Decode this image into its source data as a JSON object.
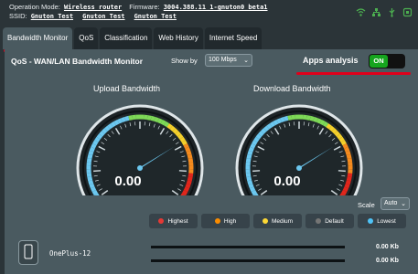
{
  "header": {
    "operation_mode_label": "Operation Mode:",
    "operation_mode": "Wireless router",
    "firmware_label": "Firmware:",
    "firmware": "3004.388.11_1-gnuton0_beta1",
    "ssid_label": "SSID:",
    "ssids": [
      "Gnuton_Test",
      "Gnuton_Test",
      "Gnuton_Test"
    ],
    "icons": [
      "wifi-icon",
      "network-icon",
      "usb-icon",
      "app-icon"
    ]
  },
  "tabs": [
    {
      "label": "Bandwidth Monitor",
      "active": true
    },
    {
      "label": "QoS"
    },
    {
      "label": "Classification"
    },
    {
      "label": "Web History"
    },
    {
      "label": "Internet Speed"
    }
  ],
  "panel": {
    "title": "QoS - WAN/LAN Bandwidth Monitor",
    "show_by_label": "Show by",
    "show_by_value": "100 Mbps",
    "apps_analysis_label": "Apps analysis",
    "apps_analysis_state": "ON",
    "upload": {
      "title": "Upload Bandwidth",
      "value": "0.00"
    },
    "download": {
      "title": "Download Bandwidth",
      "value": "0.00"
    },
    "scale_label": "Scale",
    "scale_value": "Auto",
    "legend": [
      {
        "label": "Highest",
        "color": "#e53935"
      },
      {
        "label": "High",
        "color": "#fb8c00"
      },
      {
        "label": "Medium",
        "color": "#fdd835"
      },
      {
        "label": "Default",
        "color": "#757575"
      },
      {
        "label": "Lowest",
        "color": "#4fc3f7"
      }
    ],
    "device": {
      "name": "OnePlus-12",
      "upload_rate": "0.00 Kb",
      "download_rate": "0.00 Kb",
      "upload_fill": 0,
      "download_fill": 0
    }
  }
}
